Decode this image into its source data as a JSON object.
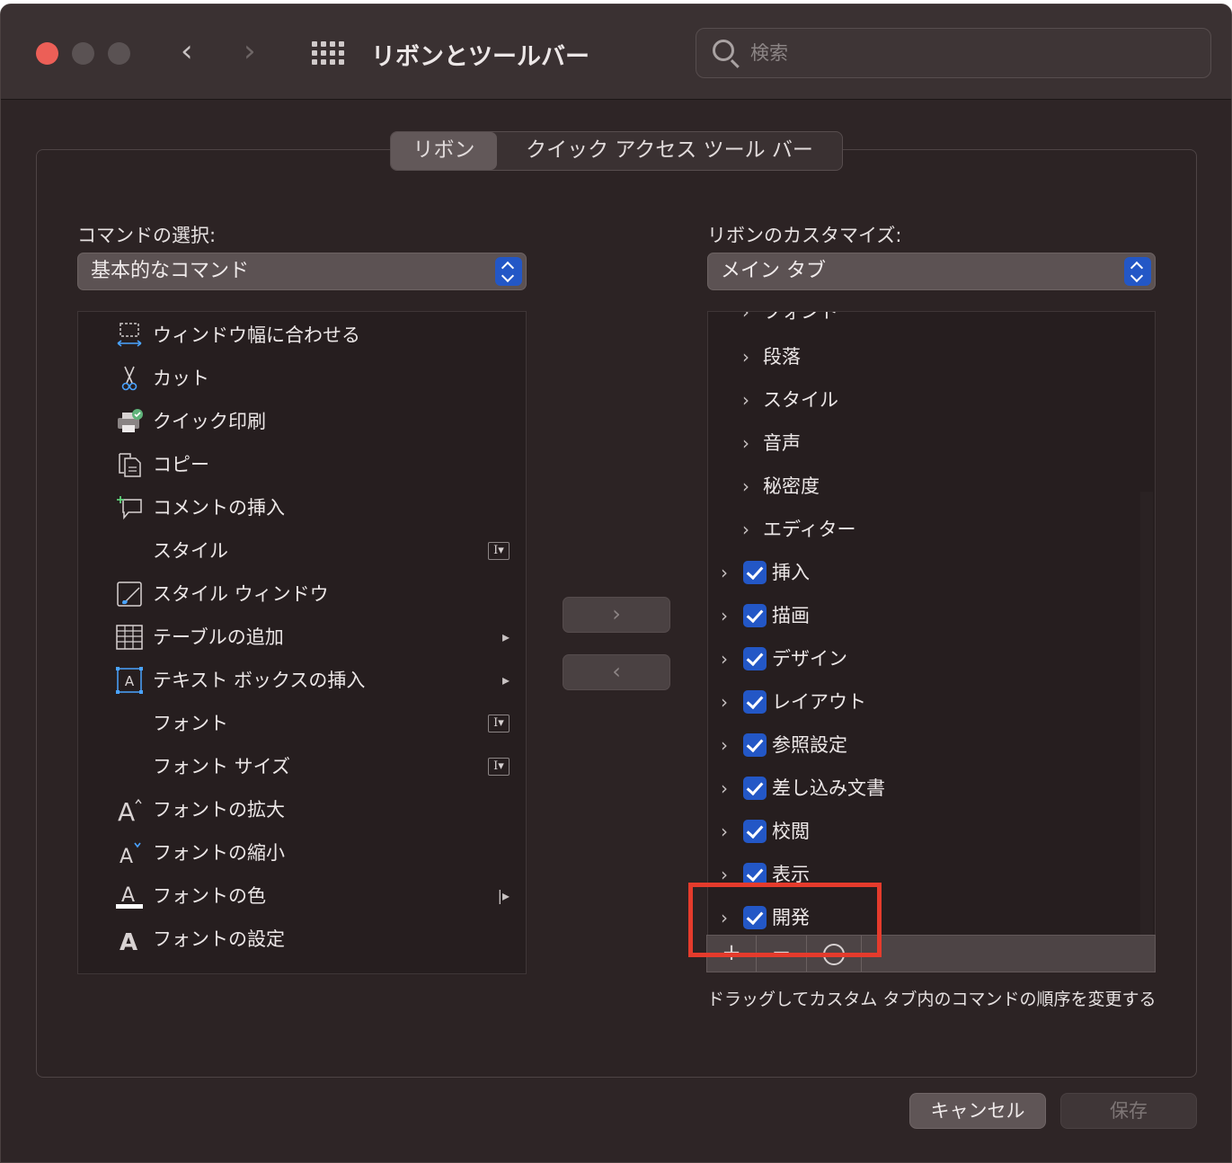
{
  "window": {
    "title": "リボンとツールバー",
    "search_placeholder": "検索",
    "nav_back": "‹",
    "nav_forward": "›"
  },
  "tabs": [
    {
      "label": "リボン",
      "active": true
    },
    {
      "label": "クイック アクセス ツール バー",
      "active": false
    }
  ],
  "left": {
    "label": "コマンドの選択:",
    "select_value": "基本的なコマンド",
    "items": [
      {
        "label": "ウィンドウ幅に合わせる",
        "icon": "fit-width-icon"
      },
      {
        "label": "カット",
        "icon": "scissors-icon"
      },
      {
        "label": "クイック印刷",
        "icon": "printer-icon"
      },
      {
        "label": "コピー",
        "icon": "copy-icon"
      },
      {
        "label": "コメントの挿入",
        "icon": "comment-insert-icon"
      },
      {
        "label": "スタイル",
        "icon": "",
        "trail": "ibeam"
      },
      {
        "label": "スタイル ウィンドウ",
        "icon": "style-window-icon"
      },
      {
        "label": "テーブルの追加",
        "icon": "table-icon",
        "trail": "submenu"
      },
      {
        "label": "テキスト ボックスの挿入",
        "icon": "textbox-icon",
        "trail": "submenu"
      },
      {
        "label": "フォント",
        "icon": "",
        "trail": "ibeam"
      },
      {
        "label": "フォント サイズ",
        "icon": "",
        "trail": "ibeam"
      },
      {
        "label": "フォントの拡大",
        "icon": "font-grow-icon"
      },
      {
        "label": "フォントの縮小",
        "icon": "font-shrink-icon"
      },
      {
        "label": "フォントの色",
        "icon": "font-color-icon",
        "trail": "split"
      },
      {
        "label": "フォントの設定",
        "icon": "font-settings-icon"
      }
    ]
  },
  "right": {
    "label": "リボンのカスタマイズ:",
    "select_value": "メイン タブ",
    "partial_top": "フォント",
    "groups": [
      "段落",
      "スタイル",
      "音声",
      "秘密度",
      "エディター"
    ],
    "tabs": [
      "挿入",
      "描画",
      "デザイン",
      "レイアウト",
      "参照設定",
      "差し込み文書",
      "校閲",
      "表示",
      "開発"
    ],
    "hint": "ドラッグしてカスタム タブ内のコマンドの順序を変更する",
    "add_symbol": "+",
    "remove_symbol": "−"
  },
  "transfer": {
    "add": "›",
    "remove": "‹"
  },
  "buttons": {
    "cancel": "キャンセル",
    "save": "保存"
  },
  "colors": {
    "accent": "#2357c6",
    "highlight": "#e53b2c",
    "close": "#ec5f57"
  }
}
